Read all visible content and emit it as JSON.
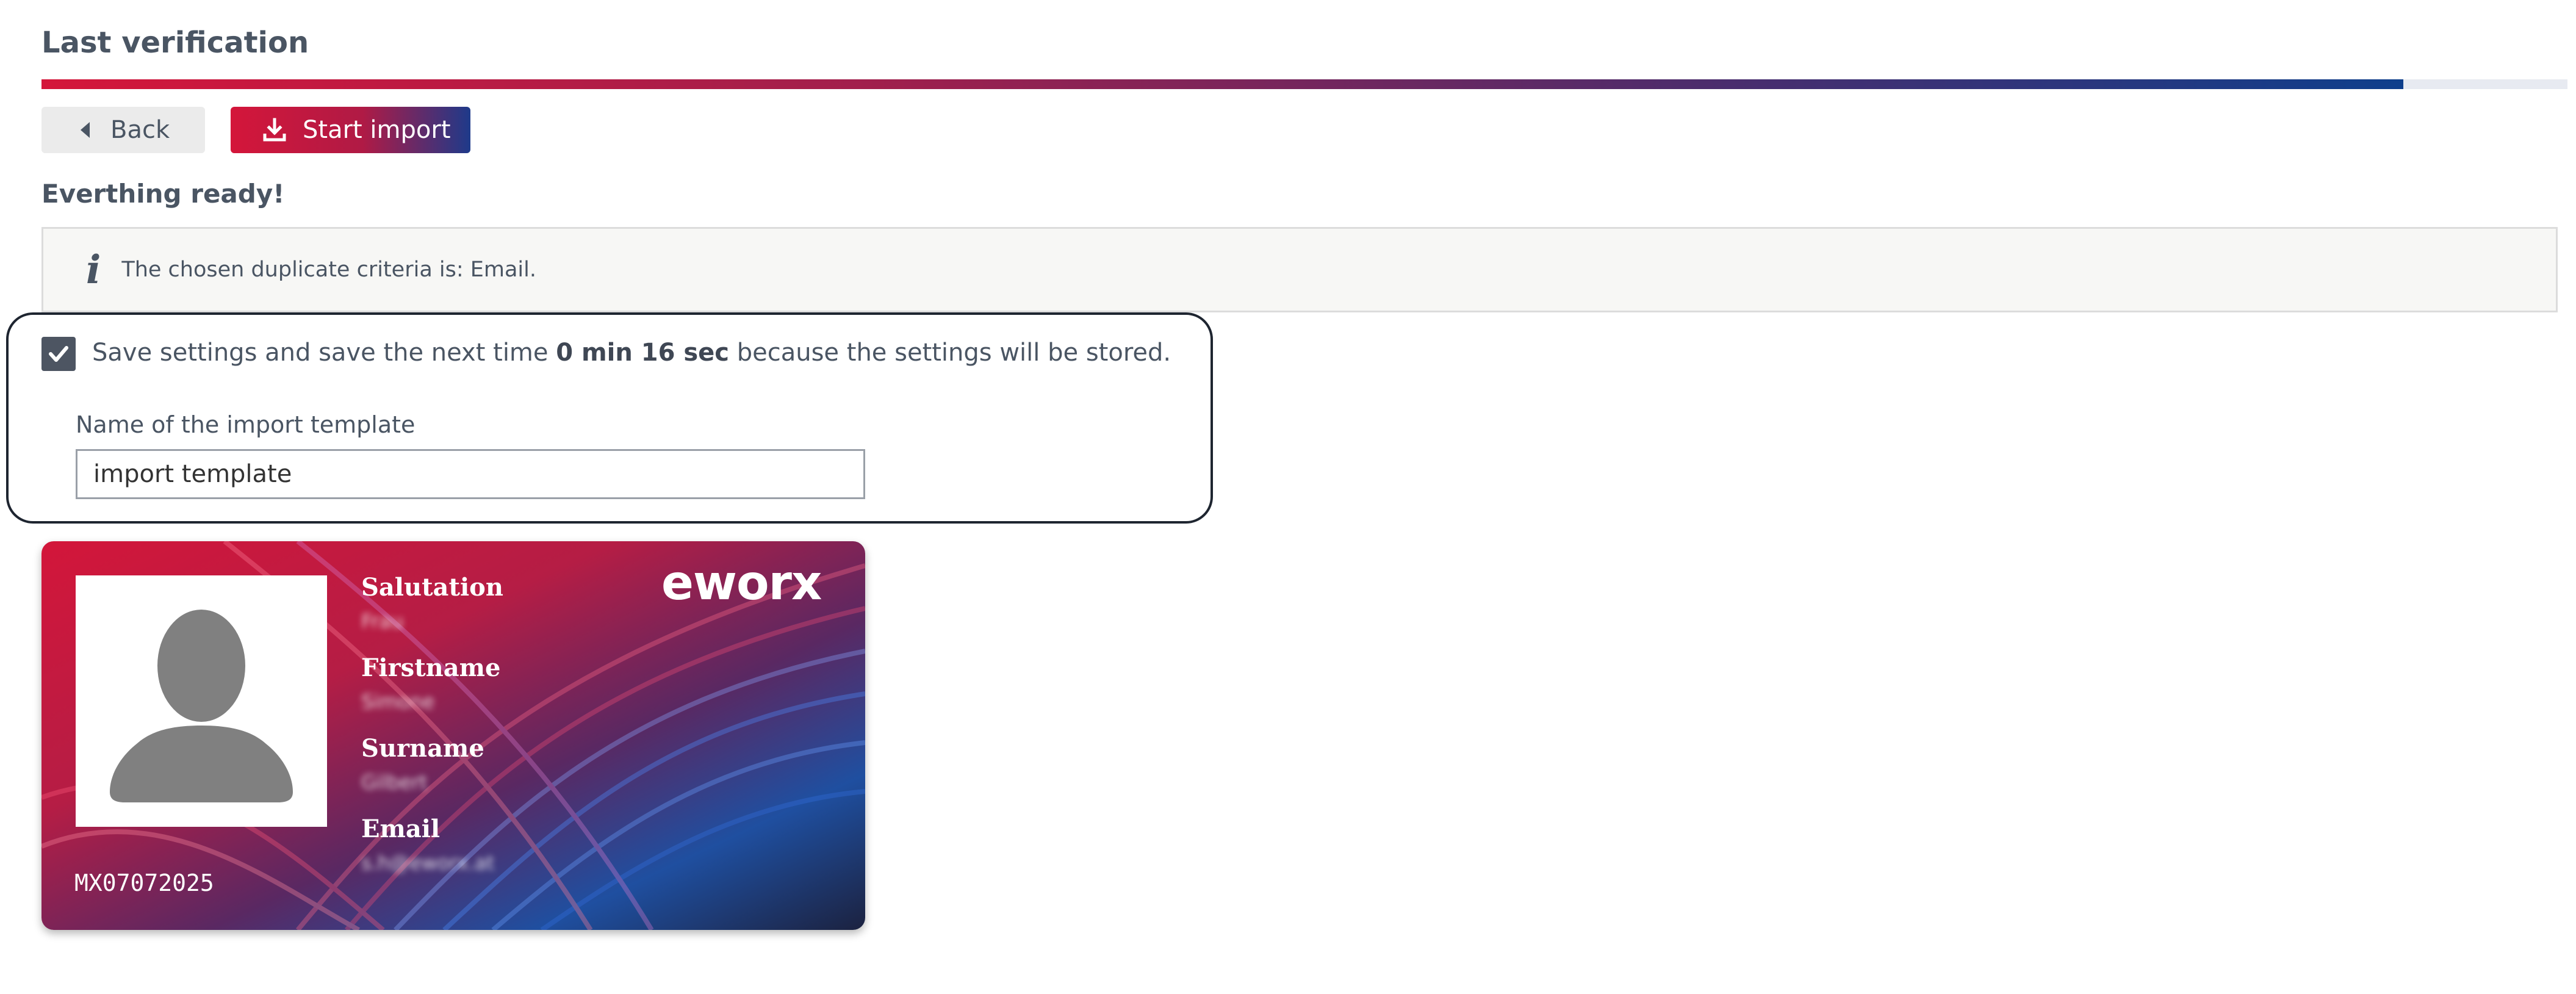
{
  "page": {
    "title": "Last verification"
  },
  "progress": {
    "percent": 93.5
  },
  "toolbar": {
    "back_label": "Back",
    "start_label": "Start import"
  },
  "status": {
    "ready_text": "Everthing ready!"
  },
  "info": {
    "text": "The chosen duplicate criteria is: Email."
  },
  "save_settings": {
    "checked": true,
    "text_before": "Save settings and save the next time",
    "time_saved": "0 min 16 sec",
    "text_after": "because the settings will be stored."
  },
  "template": {
    "label": "Name of the import template",
    "value": "import template"
  },
  "card": {
    "brand": "eworx",
    "id": "MX07072025",
    "fields": [
      {
        "label": "Salutation",
        "value": "Frau"
      },
      {
        "label": "Firstname",
        "value": "Simone"
      },
      {
        "label": "Surname",
        "value": "Gilbert"
      },
      {
        "label": "Email",
        "value": "s.h@eworx.at"
      }
    ]
  },
  "icons": {
    "back": "caret-left-icon",
    "start": "download-icon",
    "info": "info-icon",
    "check": "check-icon",
    "avatar": "user-silhouette-icon"
  },
  "colors": {
    "brand_red": "#d4163a",
    "brand_blue": "#1e3a8a",
    "text": "#4a5563"
  }
}
